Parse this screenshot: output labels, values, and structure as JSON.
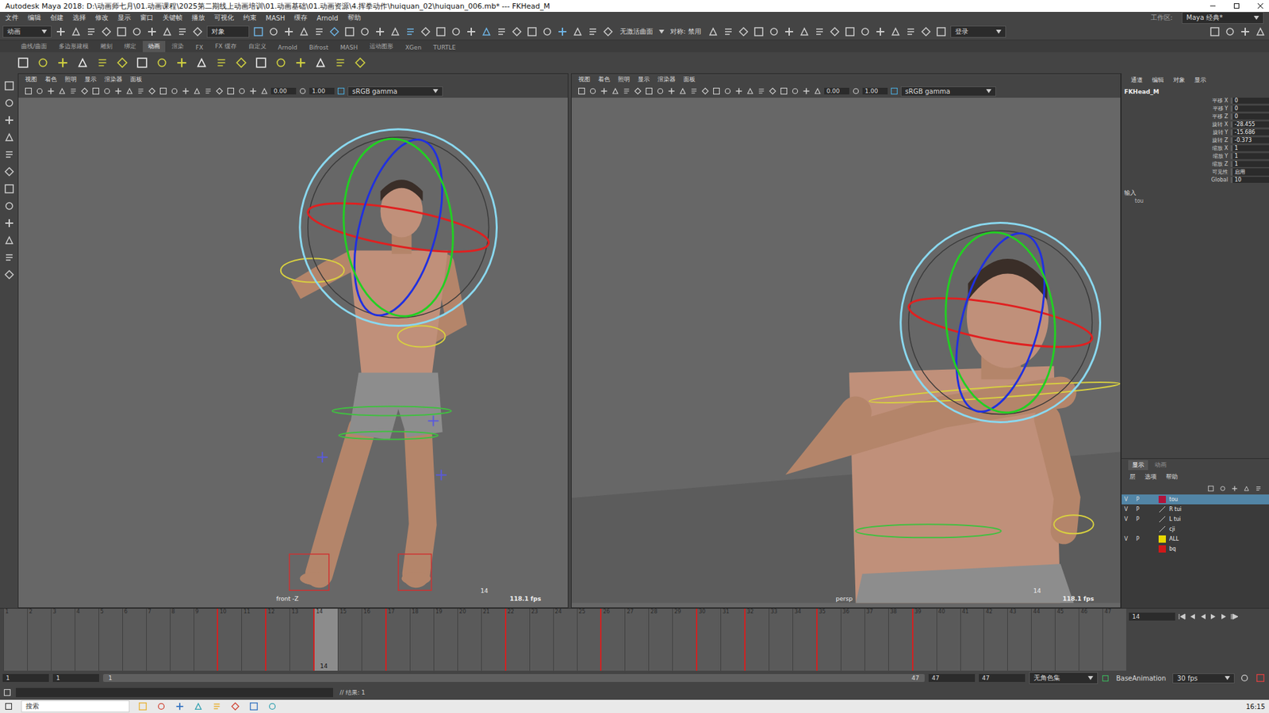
{
  "window": {
    "title": "Autodesk Maya 2018: D:\\动画师七月\\01.动画课程\\2025第二期线上动画培训\\01.动画基础\\01.动画资源\\4.挥拳动作\\huiquan_02\\huiquan_006.mb*  ---  FKHead_M"
  },
  "menubar": {
    "items": [
      "文件",
      "编辑",
      "创建",
      "选择",
      "修改",
      "显示",
      "窗口",
      "关键帧",
      "播放",
      "可视化",
      "约束",
      "MASH",
      "缓存",
      "Arnold",
      "帮助"
    ],
    "workspace_label": "工作区:",
    "workspace": "Maya 经典*"
  },
  "status_line": {
    "menu_set": "动画",
    "field": "对象",
    "live_surface": "无激活曲面",
    "symmetry": "对称: 禁用",
    "login": "登录"
  },
  "shelf": {
    "tabs": [
      {
        "label": "曲线/曲面",
        "selected": false
      },
      {
        "label": "多边形建模",
        "selected": false
      },
      {
        "label": "雕刻",
        "selected": false
      },
      {
        "label": "绑定",
        "selected": false
      },
      {
        "label": "动画",
        "selected": true
      },
      {
        "label": "渲染",
        "selected": false
      },
      {
        "label": "FX",
        "selected": false
      },
      {
        "label": "FX 缓存",
        "selected": false
      },
      {
        "label": "自定义",
        "selected": false
      },
      {
        "label": "Arnold",
        "selected": false
      },
      {
        "label": "Bifrost",
        "selected": false
      },
      {
        "label": "MASH",
        "selected": false
      },
      {
        "label": "运动图形",
        "selected": false
      },
      {
        "label": "XGen",
        "selected": false
      },
      {
        "label": "TURTLE",
        "selected": false
      }
    ]
  },
  "viewports": [
    {
      "kind": "front",
      "menus": [
        "视图",
        "着色",
        "照明",
        "显示",
        "渲染器",
        "面板"
      ],
      "exposure": "0.00",
      "gamma": "1.00",
      "color_space": "sRGB gamma",
      "camera": "front -Z",
      "frame": "14",
      "fps": "118.1 fps"
    },
    {
      "kind": "persp",
      "menus": [
        "视图",
        "着色",
        "照明",
        "显示",
        "渲染器",
        "面板"
      ],
      "exposure": "0.00",
      "gamma": "1.00",
      "color_space": "sRGB gamma",
      "camera": "persp",
      "frame": "14",
      "fps": "118.1 fps"
    }
  ],
  "channel_box": {
    "menus": [
      "通道",
      "编辑",
      "对象",
      "显示"
    ],
    "object": "FKHead_M",
    "channels": [
      {
        "label": "平移 X",
        "value": "0"
      },
      {
        "label": "平移 Y",
        "value": "0"
      },
      {
        "label": "平移 Z",
        "value": "0"
      },
      {
        "label": "旋转 X",
        "value": "-28.455"
      },
      {
        "label": "旋转 Y",
        "value": "-15.686"
      },
      {
        "label": "旋转 Z",
        "value": "-0.373"
      },
      {
        "label": "缩放 X",
        "value": "1"
      },
      {
        "label": "缩放 Y",
        "value": "1"
      },
      {
        "label": "缩放 Z",
        "value": "1"
      },
      {
        "label": "可见性",
        "value": "启用"
      },
      {
        "label": "Global",
        "value": "10"
      }
    ],
    "inputs_heading": "输入",
    "inputs": [
      "tou"
    ]
  },
  "layer_editor": {
    "tabs": [
      {
        "label": "显示",
        "selected": true
      },
      {
        "label": "动画",
        "selected": false
      }
    ],
    "menus": [
      "层",
      "选项",
      "帮助"
    ],
    "flag_v": "V",
    "flag_p": "P",
    "layers": [
      {
        "name": "tou",
        "visible": true,
        "playback": true,
        "color": "#b0143c",
        "selected": true
      },
      {
        "name": "R tui",
        "visible": true,
        "playback": true,
        "color": "",
        "selected": false
      },
      {
        "name": "L tui",
        "visible": true,
        "playback": true,
        "color": "",
        "selected": false
      },
      {
        "name": "cji",
        "visible": false,
        "playback": false,
        "color": "",
        "selected": false
      },
      {
        "name": "ALL",
        "visible": true,
        "playback": true,
        "color": "#e8d800",
        "selected": false
      },
      {
        "name": "bq",
        "visible": false,
        "playback": false,
        "color": "#d01818",
        "selected": false
      }
    ]
  },
  "timeline": {
    "ticks": [
      "1",
      "2",
      "3",
      "4",
      "5",
      "6",
      "7",
      "8",
      "9",
      "10",
      "11",
      "12",
      "13",
      "14",
      "15",
      "16",
      "17",
      "18",
      "19",
      "20",
      "21",
      "22",
      "23",
      "24",
      "25",
      "26",
      "27",
      "28",
      "29",
      "30",
      "31",
      "32",
      "33",
      "34",
      "35",
      "36",
      "37",
      "38",
      "39",
      "40",
      "41",
      "42",
      "43",
      "44",
      "45",
      "46",
      "47"
    ],
    "keys": [
      "10",
      "12",
      "14",
      "17",
      "22",
      "26",
      "30",
      "32",
      "35",
      "39"
    ],
    "current": "14",
    "current_field": "14"
  },
  "range": {
    "start": "1",
    "range_start": "1",
    "bar_start": "1",
    "bar_end": "47",
    "range_end": "47",
    "end": "47",
    "character_set": "无角色集",
    "anim_layer": "BaseAnimation",
    "fps": "30 fps"
  },
  "command_line": {
    "result": "// 结果: 1"
  },
  "taskbar": {
    "search": "搜索",
    "time": "16:15"
  }
}
